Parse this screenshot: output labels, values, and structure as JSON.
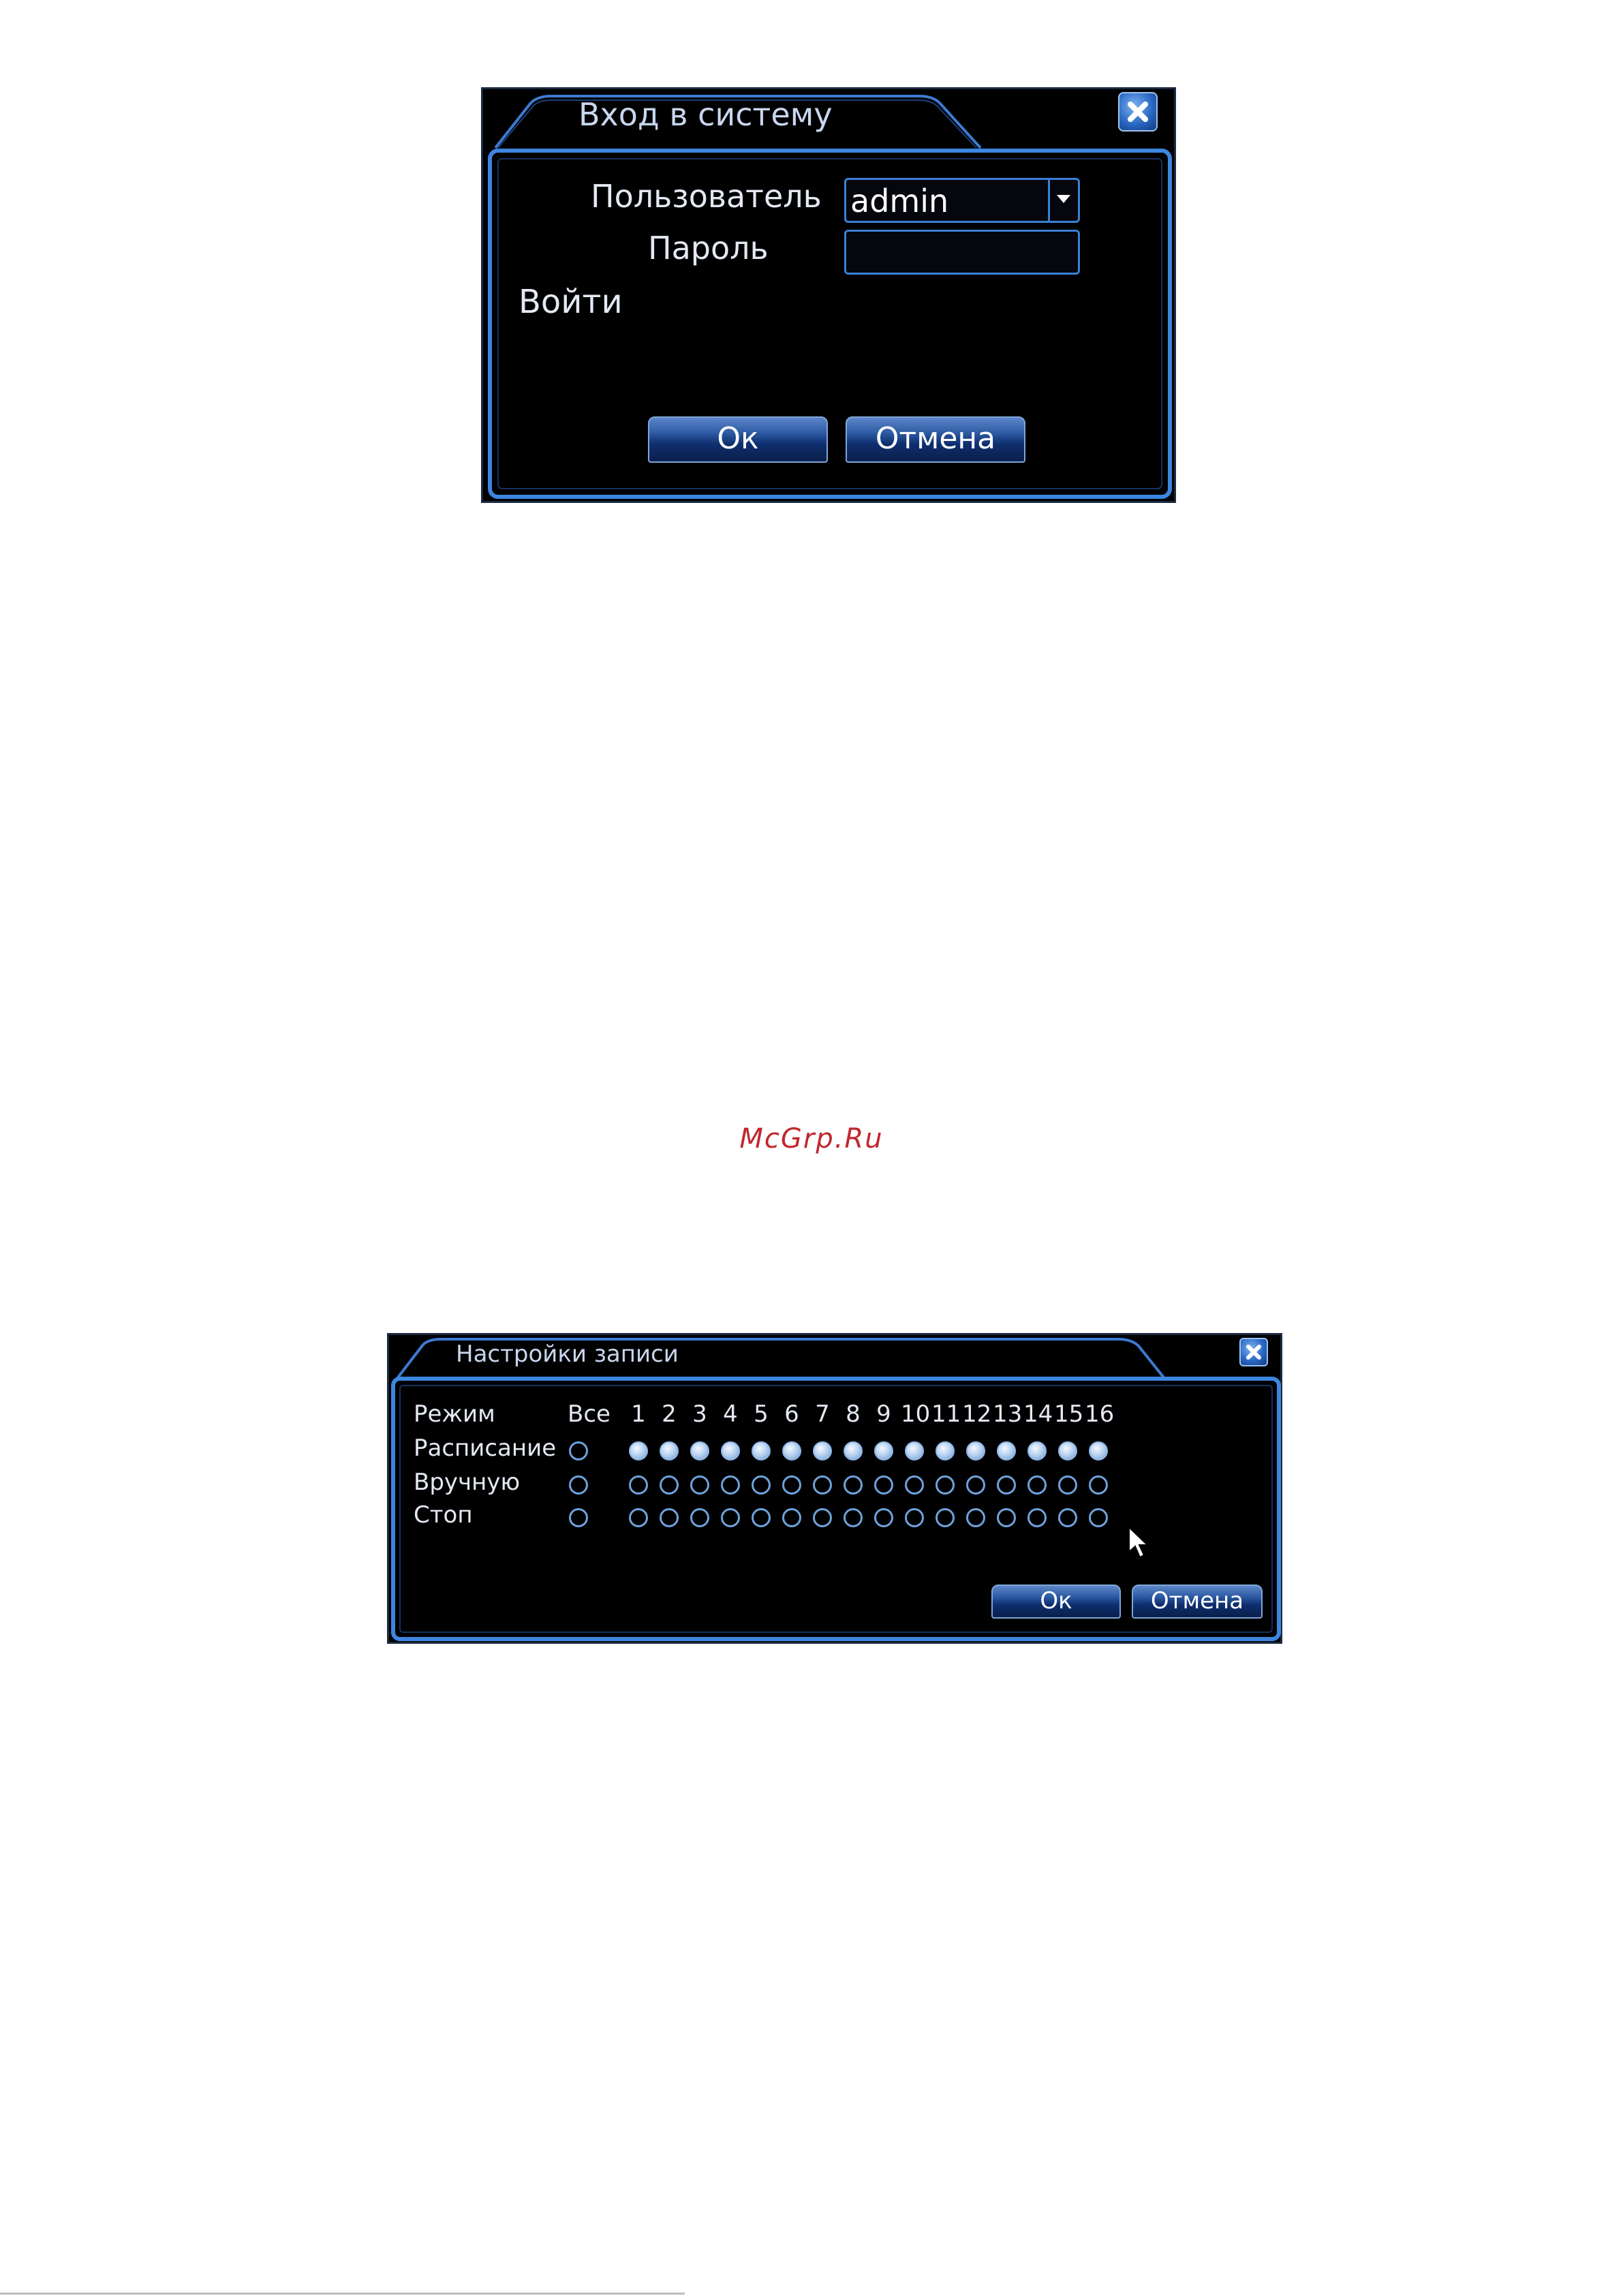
{
  "login_dialog": {
    "title": "Вход в систему",
    "user_label": "Пользователь",
    "user_value": "admin",
    "password_label": "Пароль",
    "password_value": "",
    "login_text": "Войти",
    "ok_label": "Ок",
    "cancel_label": "Отмена",
    "close_icon": "close-icon",
    "dropdown_icon": "chevron-down-icon"
  },
  "watermark": "McGrp.Ru",
  "record_dialog": {
    "title": "Настройки записи",
    "mode_label": "Режим",
    "all_label": "Все",
    "channels": [
      "1",
      "2",
      "3",
      "4",
      "5",
      "6",
      "7",
      "8",
      "9",
      "10",
      "11",
      "12",
      "13",
      "14",
      "15",
      "16"
    ],
    "rows": [
      {
        "label": "Расписание",
        "all_selected": false,
        "selected": [
          true,
          true,
          true,
          true,
          true,
          true,
          true,
          true,
          true,
          true,
          true,
          true,
          true,
          true,
          true,
          true
        ]
      },
      {
        "label": "Вручную",
        "all_selected": false,
        "selected": [
          false,
          false,
          false,
          false,
          false,
          false,
          false,
          false,
          false,
          false,
          false,
          false,
          false,
          false,
          false,
          false
        ]
      },
      {
        "label": "Стоп",
        "all_selected": false,
        "selected": [
          false,
          false,
          false,
          false,
          false,
          false,
          false,
          false,
          false,
          false,
          false,
          false,
          false,
          false,
          false,
          false
        ]
      }
    ],
    "ok_label": "Ок",
    "cancel_label": "Отмена",
    "close_icon": "close-icon",
    "cursor_icon": "mouse-pointer-icon"
  },
  "colors": {
    "accent": "#3b7fd6",
    "panel_bg": "#000000",
    "watermark": "#c1272d"
  }
}
